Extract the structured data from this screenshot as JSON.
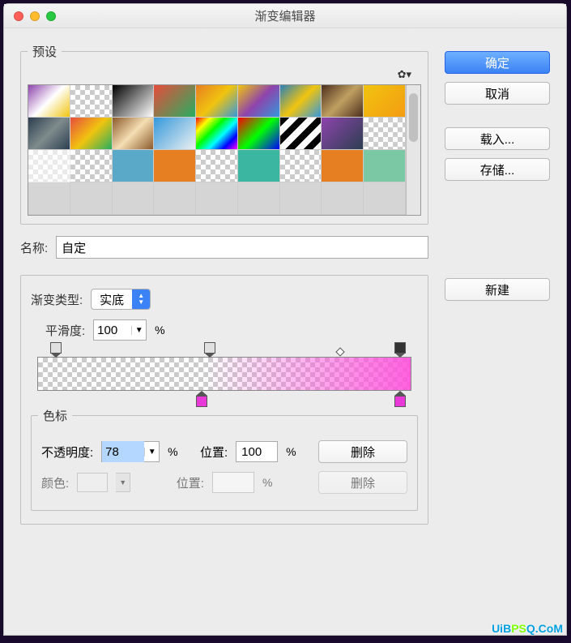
{
  "window": {
    "title": "渐变编辑器"
  },
  "presets": {
    "legend": "预设",
    "gear_icon": "gear-icon",
    "swatches": [
      "linear-gradient(135deg,#8e44ad,#fff,#f1c40f)",
      "checker",
      "linear-gradient(135deg,#000,#fff)",
      "linear-gradient(135deg,#e74c3c,#27ae60)",
      "linear-gradient(135deg,#e67e22,#f1c40f,#3498db)",
      "linear-gradient(135deg,#f1c40f,#8e44ad,#3498db)",
      "linear-gradient(135deg,#2980b9,#f1c40f,#3498db)",
      "linear-gradient(135deg,#4b2e1e,#c0a060,#4b2e1e)",
      "linear-gradient(135deg,#f1c40f,#f39c12)",
      "linear-gradient(135deg,#2c3e50,#7f8c8d,#2c3e50)",
      "linear-gradient(135deg,#e74c3c,#f1c40f,#27ae60)",
      "linear-gradient(135deg,#8b5a2b,#f5deb3,#8b5a2b)",
      "linear-gradient(135deg,#3498db,#ecf0f1)",
      "linear-gradient(135deg,#ff0000,#ffff00,#00ff00,#00ffff,#0000ff,#ff00ff)",
      "linear-gradient(135deg,#ff0000,#00ff00,#0000ff)",
      "repeating-linear-gradient(135deg,#000 0 8px,#fff 8px 16px)",
      "linear-gradient(135deg,#8e44ad,#2c3e50)",
      "checker",
      "checker-lt",
      "checker",
      "#5aa9c8",
      "#e67e22",
      "checker",
      "#3bb6a0",
      "checker",
      "#e67e22",
      "#7bc8a4"
    ],
    "blank_row_bg": "#d5d5d5"
  },
  "name": {
    "label": "名称:",
    "value": "自定"
  },
  "buttons": {
    "ok": "确定",
    "cancel": "取消",
    "load": "载入...",
    "save": "存储...",
    "new": "新建"
  },
  "gradient": {
    "type_label": "渐变类型:",
    "type_value": "实底",
    "smooth_label": "平滑度:",
    "smooth_value": "100",
    "percent": "%",
    "opacity_stops": [
      {
        "pos": 5
      },
      {
        "pos": 46
      },
      {
        "pos": 97,
        "selected": true
      }
    ],
    "midpoint": {
      "pos": 81
    },
    "color_stops": [
      {
        "pos": 44,
        "color": "#e838d8"
      },
      {
        "pos": 97,
        "color": "#e838d8"
      }
    ]
  },
  "stops": {
    "legend": "色标",
    "opacity_label": "不透明度:",
    "opacity_value": "78",
    "position_label": "位置:",
    "position_value": "100",
    "delete_label": "删除",
    "color_label": "颜色:",
    "color_position": "",
    "percent": "%"
  },
  "footer": {
    "brand1": "UiB",
    "brand2": "Q",
    "brand3": ".C",
    "brand4": "o",
    "brand5": "M",
    "ps": "PS"
  }
}
